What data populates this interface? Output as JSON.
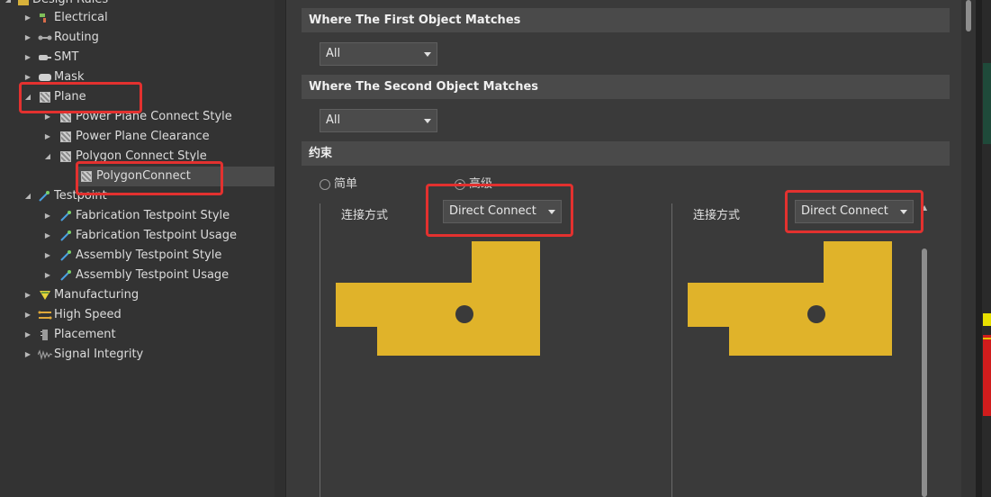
{
  "tree": {
    "root_label": "Design Rules",
    "items": [
      {
        "label": "Electrical",
        "icon": "electrical-icon"
      },
      {
        "label": "Routing",
        "icon": "routing-icon"
      },
      {
        "label": "SMT",
        "icon": "smt-icon"
      },
      {
        "label": "Mask",
        "icon": "mask-icon"
      },
      {
        "label": "Plane",
        "icon": "plane-icon"
      },
      {
        "label": "Power Plane Connect Style",
        "icon": "plane-icon"
      },
      {
        "label": "Power Plane Clearance",
        "icon": "plane-icon"
      },
      {
        "label": "Polygon Connect Style",
        "icon": "plane-icon"
      },
      {
        "label": "PolygonConnect",
        "icon": "plane-icon"
      },
      {
        "label": "Testpoint",
        "icon": "testpoint-icon"
      },
      {
        "label": "Fabrication Testpoint Style",
        "icon": "testpoint-icon"
      },
      {
        "label": "Fabrication Testpoint Usage",
        "icon": "testpoint-icon"
      },
      {
        "label": "Assembly Testpoint Style",
        "icon": "testpoint-icon"
      },
      {
        "label": "Assembly Testpoint Usage",
        "icon": "testpoint-icon"
      },
      {
        "label": "Manufacturing",
        "icon": "manufacturing-icon"
      },
      {
        "label": "High Speed",
        "icon": "high-speed-icon"
      },
      {
        "label": "Placement",
        "icon": "placement-icon"
      },
      {
        "label": "Signal Integrity",
        "icon": "signal-integrity-icon"
      }
    ]
  },
  "main": {
    "first_match": {
      "title": "Where The First Object Matches",
      "value": "All"
    },
    "second_match": {
      "title": "Where The Second Object Matches",
      "value": "All"
    },
    "constraints": {
      "title": "约束",
      "mode_simple": "简单",
      "mode_advanced": "高级",
      "selected_mode": "advanced",
      "left": {
        "label": "连接方式",
        "value": "Direct Connect"
      },
      "right": {
        "label": "连接方式",
        "value": "Direct Connect"
      }
    }
  },
  "colors": {
    "highlight": "#e3312f",
    "copper": "#e0b32a",
    "pad": "#3a3a3a",
    "panel": "#3a3a3a",
    "section_header": "#4a4a4a"
  }
}
